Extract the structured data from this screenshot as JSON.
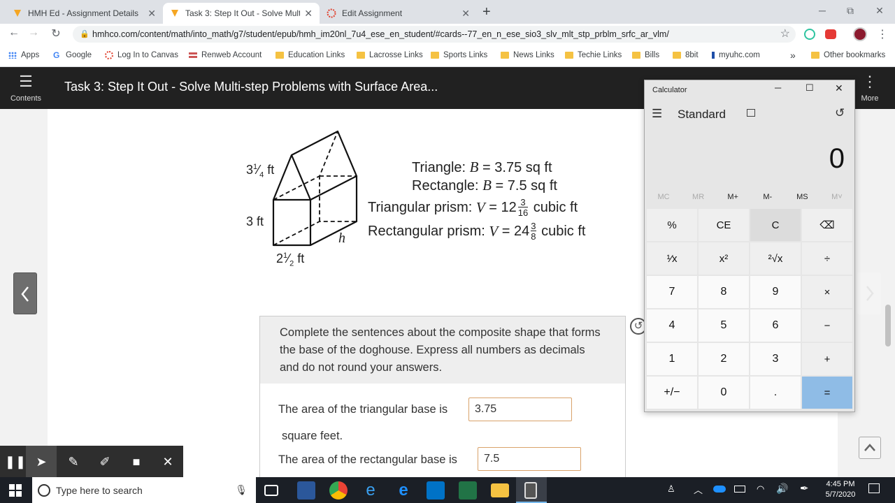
{
  "browser": {
    "tabs": [
      {
        "title": "HMH Ed - Assignment Details",
        "active": false
      },
      {
        "title": "Task 3: Step It Out - Solve Multi-",
        "active": true
      },
      {
        "title": "Edit Assignment",
        "active": false
      }
    ],
    "new_tab": "+",
    "window_controls": {
      "minimize": "─",
      "maximize": "⧉",
      "close": "✕"
    },
    "url": "hmhco.com/content/math/into_math/g7/student/epub/hmh_im20nl_7u4_ese_en_student/#cards--77_en_n_ese_sio3_slv_mlt_stp_prblm_srfc_ar_vlm/",
    "bookmarks": [
      "Apps",
      "Google",
      "Log In to Canvas",
      "Renweb Account",
      "Education Links",
      "Lacrosse Links",
      "Sports Links",
      "News Links",
      "Techie Links",
      "Bills",
      "8bit",
      "myuhc.com"
    ],
    "bookmarks_overflow": "»",
    "other_bookmarks": "Other bookmarks"
  },
  "app": {
    "contents_label": "Contents",
    "title": "Task 3: Step It Out - Solve Multi-step Problems with Surface Area...",
    "more_label": "More"
  },
  "figure": {
    "dim_top": "3¼ ft",
    "dim_side": "3 ft",
    "dim_bottom": "2½ ft",
    "dim_h": "h"
  },
  "formulas": {
    "triangle": {
      "prefix": "Triangle: ",
      "var": "B",
      "rest": " = 3.75 sq ft"
    },
    "rectangle": {
      "prefix": "Rectangle: ",
      "var": "B",
      "rest": " = 7.5 sq ft"
    },
    "tri_prism": {
      "prefix": "Triangular prism: ",
      "var": "V",
      "eq": " = 12",
      "num": "3",
      "den": "16",
      "unit": " cubic ft"
    },
    "rect_prism": {
      "prefix": "Rectangular prism: ",
      "var": "V",
      "eq": " = 24",
      "num": "3",
      "den": "8",
      "unit": " cubic ft"
    }
  },
  "question": {
    "prompt": "Complete the sentences about the composite shape that forms the base of the doghouse. Express all numbers as decimals and do not round your answers.",
    "line1": "The area of the triangular base is",
    "answer1": "3.75",
    "line1_unit": "square feet.",
    "line2": "The area of the rectangular base is",
    "answer2": "7.5"
  },
  "calculator": {
    "window_title": "Calculator",
    "mode": "Standard",
    "display": "0",
    "memory": [
      "MC",
      "MR",
      "M+",
      "M-",
      "MS",
      "M˅"
    ],
    "keys": [
      [
        "%",
        "CE",
        "C",
        "⌫"
      ],
      [
        "¹⁄x",
        "x²",
        "²√x",
        "÷"
      ],
      [
        "7",
        "8",
        "9",
        "×"
      ],
      [
        "4",
        "5",
        "6",
        "−"
      ],
      [
        "1",
        "2",
        "3",
        "+"
      ],
      [
        "+/−",
        "0",
        ".",
        "="
      ]
    ],
    "accent": "#8fbce6"
  },
  "taskbar": {
    "search_placeholder": "Type here to search",
    "time": "4:45 PM",
    "date": "5/7/2020"
  }
}
